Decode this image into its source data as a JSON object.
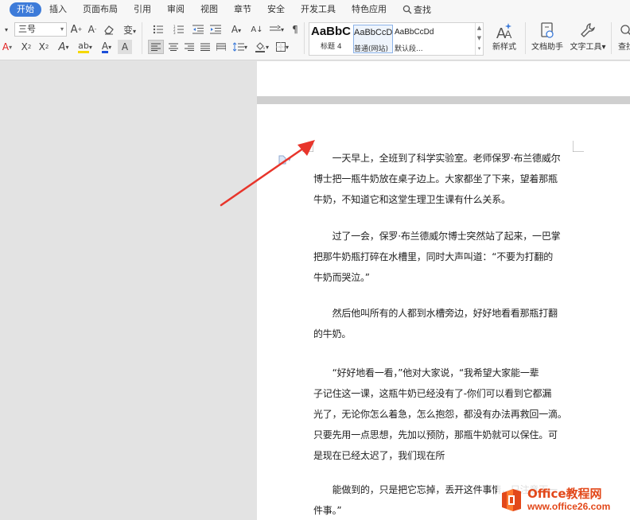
{
  "menu": {
    "tabs": [
      "开始",
      "插入",
      "页面布局",
      "引用",
      "审阅",
      "视图",
      "章节",
      "安全",
      "开发工具",
      "特色应用"
    ],
    "search_label": "查找"
  },
  "ribbon": {
    "font_size": "三号",
    "styles": [
      {
        "sample": "AaBbC",
        "label": "标题 4"
      },
      {
        "sample": "AaBbCcD",
        "label": "普通(网站)"
      },
      {
        "sample": "AaBbCcDd",
        "label": "默认段..."
      }
    ],
    "new_style_label": "新样式",
    "doc_assistant_label": "文档助手",
    "text_tools_label": "文字工具",
    "find_label": "查找",
    "accent_colors": {
      "font_color": "#e02020",
      "highlight": "#f5d800",
      "text_color_a": "#1c4fd8"
    }
  },
  "document": {
    "paragraphs": [
      {
        "lines": [
          "　　一天早上，全班到了科学实验室。老师保罗·布兰德威尔",
          "博士把一瓶牛奶放在桌子边上。大家都坐了下来，望着那瓶",
          "牛奶，不知道它和这堂生理卫生课有什么关系。"
        ]
      },
      {
        "lines": [
          "　　过了一会，保罗·布兰德威尔博士突然站了起来，一巴掌",
          "把那牛奶瓶打碎在水槽里，同时大声叫道：“不要为打翻的",
          "牛奶而哭泣。”"
        ]
      },
      {
        "lines": [
          "　　然后他叫所有的人都到水槽旁边，好好地看看那瓶打翻",
          "的牛奶。"
        ]
      },
      {
        "lines": [
          "　　“好好地看一看，”他对大家说，“我希望大家能一辈",
          "子记住这一课，这瓶牛奶已经没有了-你们可以看到它都漏",
          "光了，无论你怎么着急，怎么抱怨，都没有办法再救回一滴。",
          "只要先用一点思想，先加以预防，那瓶牛奶就可以保住。可",
          "是现在已经太迟了，我们现在所"
        ]
      },
      {
        "lines": [
          "　　能做到的，只是把它忘掉，丢开这件事情，只注意下一",
          "件事。”"
        ]
      }
    ]
  },
  "watermark": {
    "title": "Office教程网",
    "url": "www.office26.com"
  }
}
